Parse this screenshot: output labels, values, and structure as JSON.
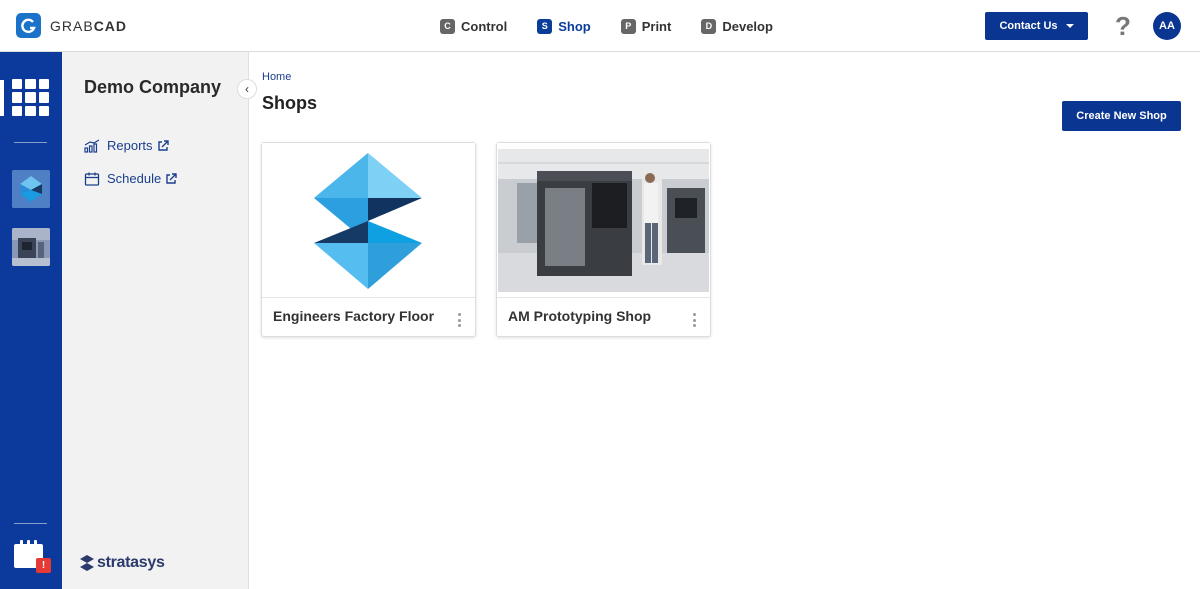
{
  "app": {
    "brand_prefix": "GRAB",
    "brand_suffix": "CAD",
    "logo_letter": "G"
  },
  "nav": [
    {
      "badge": "C",
      "label": "Control",
      "active": false
    },
    {
      "badge": "S",
      "label": "Shop",
      "active": true
    },
    {
      "badge": "P",
      "label": "Print",
      "active": false
    },
    {
      "badge": "D",
      "label": "Develop",
      "active": false
    }
  ],
  "header": {
    "contact_label": "Contact Us",
    "help_glyph": "?",
    "avatar_initials": "AA"
  },
  "rail": {
    "alert_glyph": "!"
  },
  "panel": {
    "company": "Demo Company",
    "collapse_glyph": "‹",
    "links": [
      {
        "label": "Reports",
        "icon": "bar-chart-icon"
      },
      {
        "label": "Schedule",
        "icon": "calendar-icon"
      }
    ],
    "footer_logo": "stratasys"
  },
  "main": {
    "breadcrumb": "Home",
    "title": "Shops",
    "create_label": "Create New Shop",
    "cards": [
      {
        "title": "Engineers Factory Floor",
        "image": "stratasys-logo"
      },
      {
        "title": "AM Prototyping Shop",
        "image": "printer-photo"
      }
    ]
  },
  "colors": {
    "brand_blue": "#0a3590",
    "rail_blue": "#0c3a9c",
    "link_blue": "#1a3f8f",
    "alert_red": "#e53935"
  }
}
